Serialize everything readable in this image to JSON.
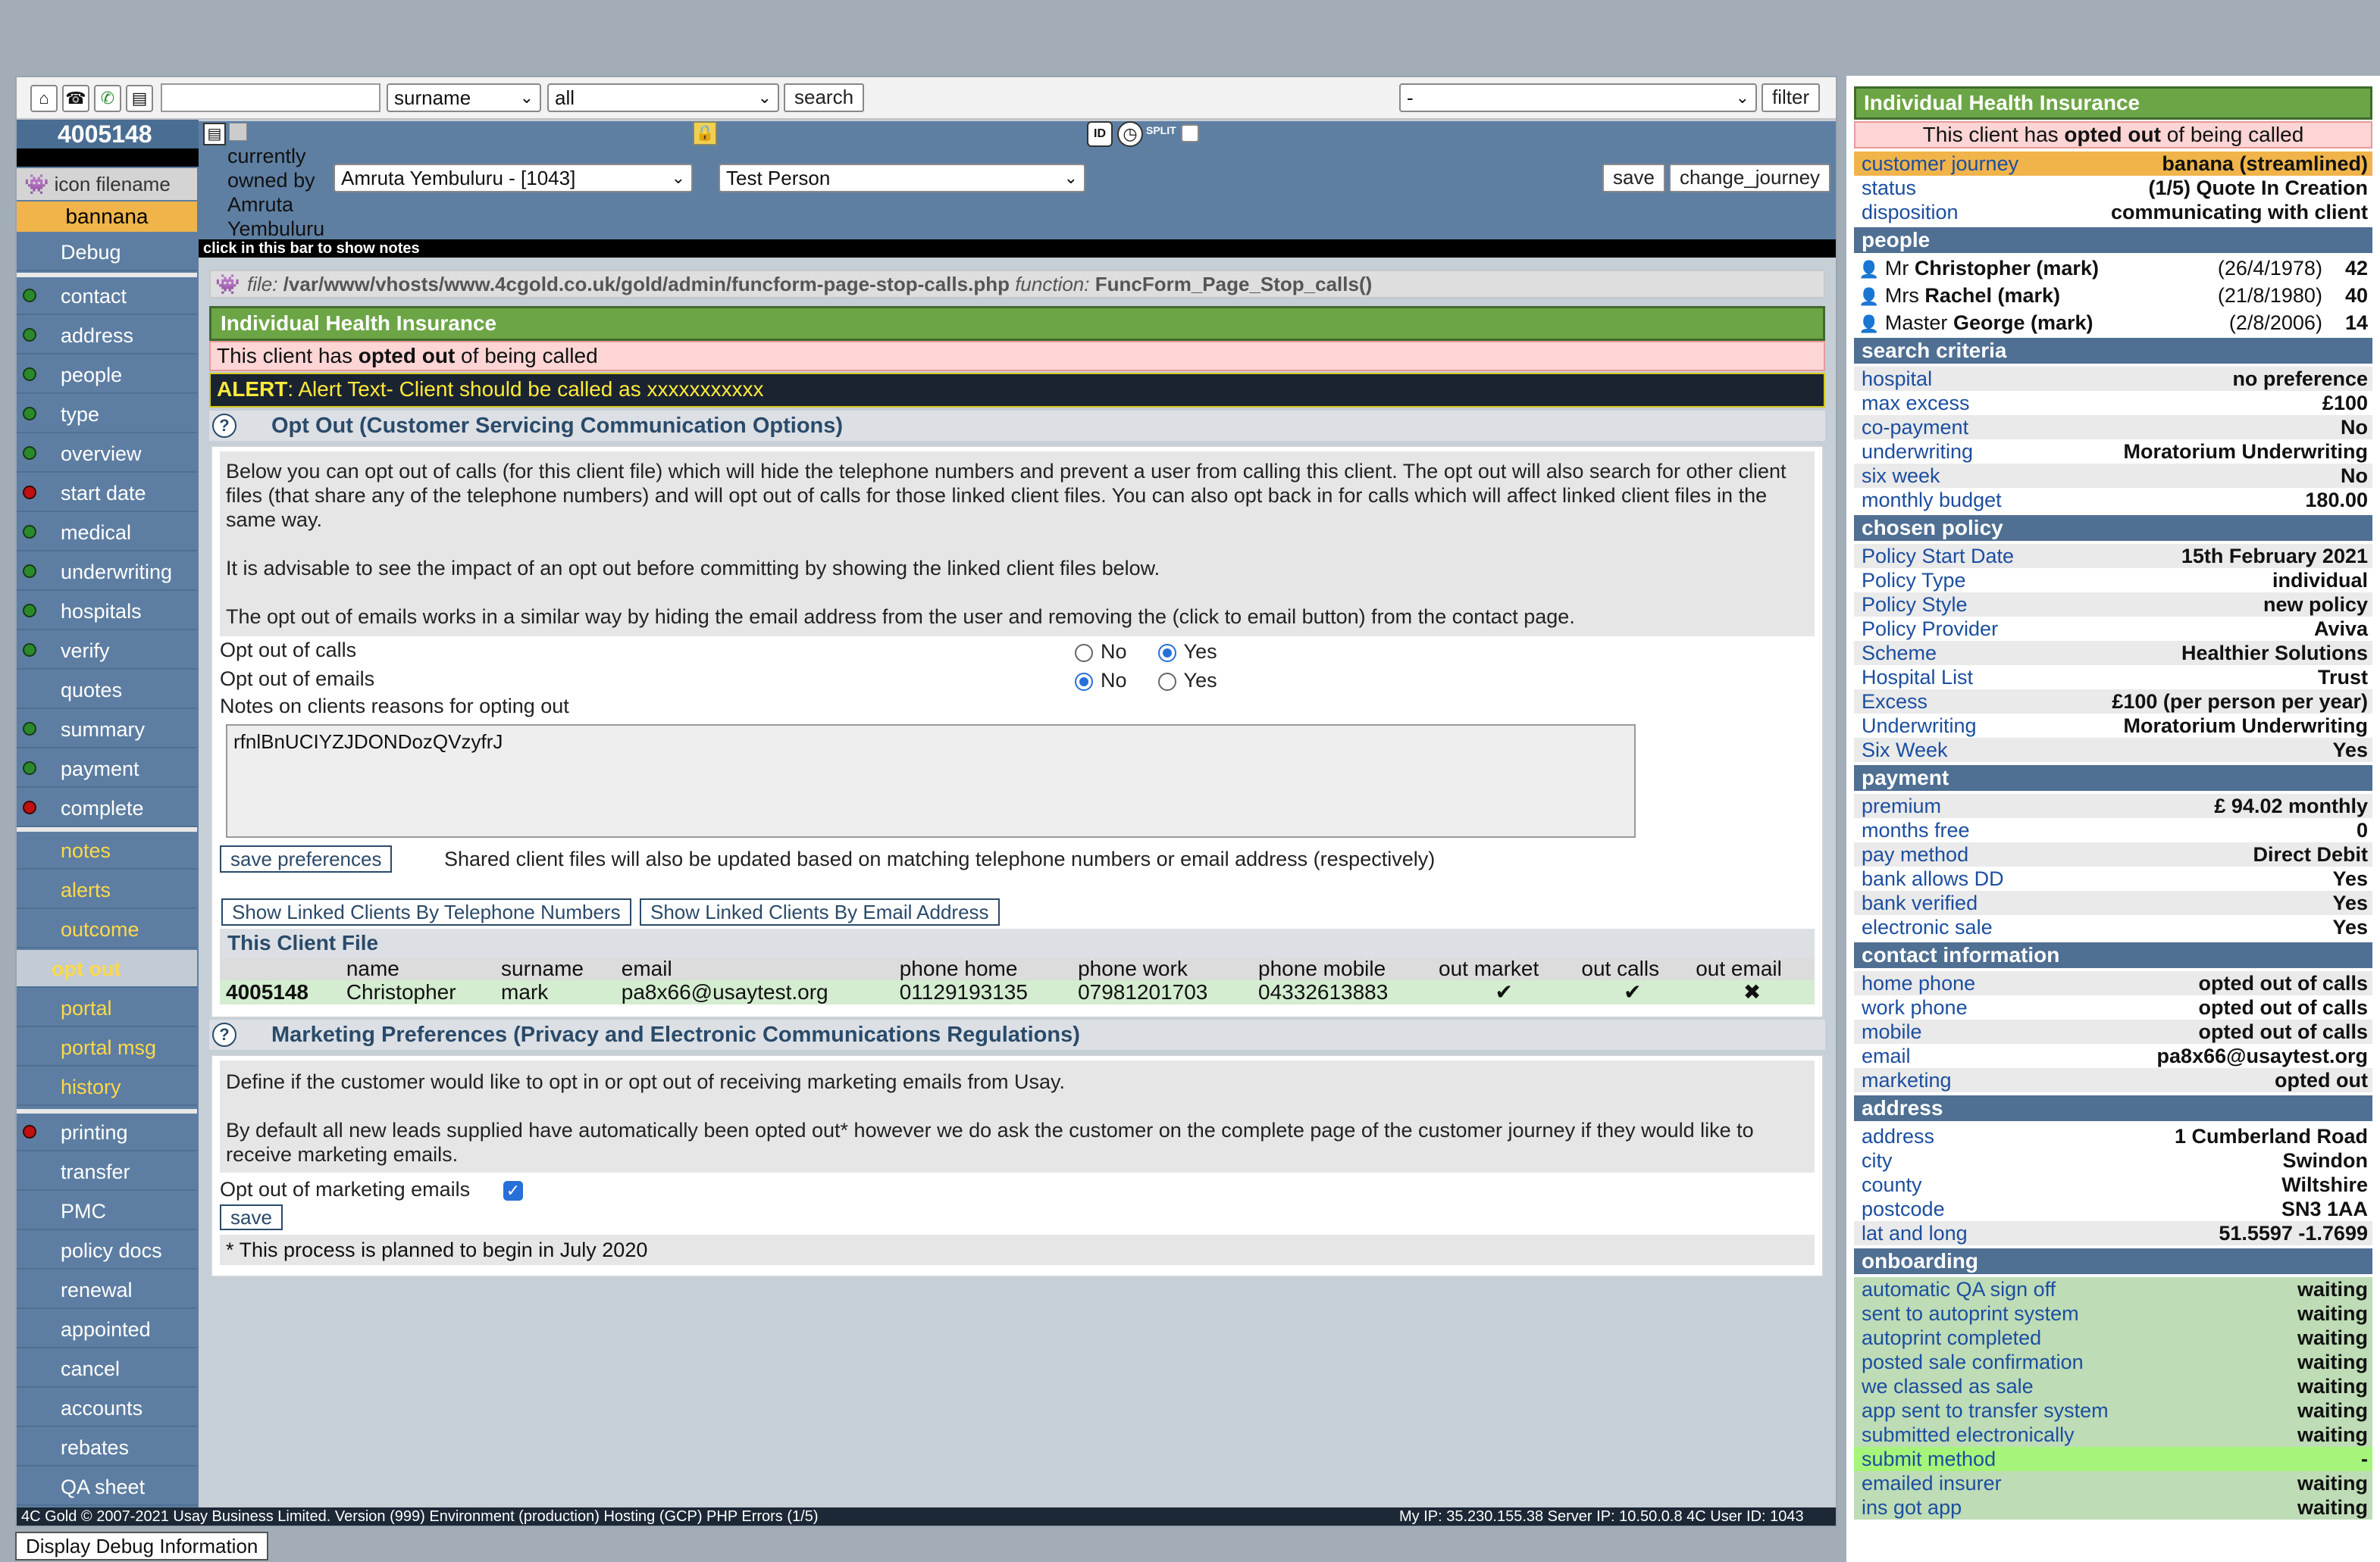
{
  "toolbar": {
    "search_value": "",
    "field_select": "surname",
    "scope_select": "all",
    "search_label": "search",
    "filter_select": "-",
    "filter_label": "filter"
  },
  "client": {
    "id": "4005148",
    "icon_filename": "icon filename",
    "journey_tag": "bannana"
  },
  "header": {
    "owned_label": "currently owned by Amruta Yembuluru",
    "owner_select": "Amruta Yembuluru - [1043]",
    "person_select": "Test Person",
    "save_label": "save",
    "change_journey_label": "change_journey",
    "notes_bar": "click in this bar to show notes",
    "split_label": "SPLIT"
  },
  "sidebar": {
    "debug": "Debug",
    "group1": [
      {
        "label": "contact",
        "status": "green"
      },
      {
        "label": "address",
        "status": "green"
      },
      {
        "label": "people",
        "status": "green"
      },
      {
        "label": "type",
        "status": "green"
      },
      {
        "label": "overview",
        "status": "green"
      },
      {
        "label": "start date",
        "status": "red"
      },
      {
        "label": "medical",
        "status": "green"
      },
      {
        "label": "underwriting",
        "status": "green"
      },
      {
        "label": "hospitals",
        "status": "green"
      },
      {
        "label": "verify",
        "status": "green"
      },
      {
        "label": "quotes",
        "status": "none"
      },
      {
        "label": "summary",
        "status": "green"
      },
      {
        "label": "payment",
        "status": "green"
      },
      {
        "label": "complete",
        "status": "red"
      }
    ],
    "group2": [
      "notes",
      "alerts",
      "outcome",
      "opt out",
      "portal",
      "portal msg",
      "history"
    ],
    "group3": [
      {
        "label": "printing",
        "status": "red"
      },
      {
        "label": "transfer"
      },
      {
        "label": "PMC"
      },
      {
        "label": "policy docs"
      },
      {
        "label": "renewal"
      },
      {
        "label": "appointed"
      },
      {
        "label": "cancel"
      },
      {
        "label": "accounts"
      },
      {
        "label": "rebates"
      },
      {
        "label": "QA sheet"
      }
    ]
  },
  "main": {
    "file_label": "file:",
    "file_path": "/var/www/vhosts/www.4cgold.co.uk/gold/admin/funcform-page-stop-calls.php",
    "function_label": "function:",
    "function_name": "FuncForm_Page_Stop_calls()",
    "product": "Individual Health Insurance",
    "optout_banner_a": "This client has ",
    "optout_banner_b": "opted out",
    "optout_banner_c": " of being called",
    "alert_label": "ALERT",
    "alert_text": ": Alert Text- Client should be called as xxxxxxxxxxx",
    "section1_title": "Opt Out (Customer Servicing Communication Options)",
    "p1": "Below you can opt out of calls (for this client file) which will hide the telephone numbers and prevent a user from calling this client. The opt out will also search for other client files (that share any of the telephone numbers) and will opt out of calls for those linked client files. You can also opt back in for calls which will affect linked client files in the same way.",
    "p2": "It is advisable to see the impact of an opt out before committing by showing the linked client files below.",
    "p3": "The opt out of emails works in a similar way by hiding the email address from the user and removing the (click to email button) from the contact page.",
    "opt_calls_label": "Opt out of calls",
    "opt_emails_label": "Opt out of emails",
    "no": "No",
    "yes": "Yes",
    "opt_calls_value": "Yes",
    "opt_emails_value": "No",
    "notes_label": "Notes on clients reasons for opting out",
    "notes_value": "rfnlBnUCIYZJDONDozQVzyfrJ",
    "save_prefs_label": "save preferences",
    "shared_note": "Shared client files will also be updated based on matching telephone numbers or email address (respectively)",
    "show_phone_label": "Show Linked Clients By Telephone Numbers",
    "show_email_label": "Show Linked Clients By Email Address",
    "this_client_file": "This Client File",
    "table_headers": [
      "",
      "name",
      "surname",
      "email",
      "phone home",
      "phone work",
      "phone mobile",
      "out market",
      "out calls",
      "out email"
    ],
    "table_row": [
      "4005148",
      "Christopher",
      "mark",
      "pa8x66@usaytest.org",
      "01129193135",
      "07981201703",
      "04332613883",
      "✔",
      "✔",
      "✖"
    ],
    "section2_title": "Marketing Preferences (Privacy and Electronic Communications Regulations)",
    "m1": "Define if the customer would like to opt in or opt out of receiving marketing emails from Usay.",
    "m2": "By default all new leads supplied have automatically been opted out* however we do ask the customer on the complete page of the customer journey if they would like to receive marketing emails.",
    "opt_marketing_label": "Opt out of marketing emails",
    "opt_marketing_checked": true,
    "save_label": "save",
    "planned_note": "* This process is planned to begin in July 2020"
  },
  "right": {
    "product": "Individual Health Insurance",
    "banner_a": "This client has ",
    "banner_b": "opted out",
    "banner_c": " of being called",
    "top": [
      {
        "k": "customer journey",
        "v": "banana (streamlined)"
      },
      {
        "k": "status",
        "v": "(1/5) Quote In Creation"
      },
      {
        "k": "disposition",
        "v": "communicating with client"
      }
    ],
    "people_head": "people",
    "people": [
      {
        "title": "Mr",
        "name": "Christopher (mark)",
        "dob": "(26/4/1978)",
        "age": "42"
      },
      {
        "title": "Mrs",
        "name": "Rachel (mark)",
        "dob": "(21/8/1980)",
        "age": "40"
      },
      {
        "title": "Master",
        "name": "George (mark)",
        "dob": "(2/8/2006)",
        "age": "14"
      }
    ],
    "search_head": "search criteria",
    "search": [
      {
        "k": "hospital",
        "v": "no preference"
      },
      {
        "k": "max excess",
        "v": "£100"
      },
      {
        "k": "co-payment",
        "v": "No"
      },
      {
        "k": "underwriting",
        "v": "Moratorium Underwriting"
      },
      {
        "k": "six week",
        "v": "No"
      },
      {
        "k": "monthly budget",
        "v": "180.00"
      }
    ],
    "policy_head": "chosen policy",
    "policy": [
      {
        "k": "Policy Start Date",
        "v": "15th February 2021"
      },
      {
        "k": "Policy Type",
        "v": "individual"
      },
      {
        "k": "Policy Style",
        "v": "new policy"
      },
      {
        "k": "Policy Provider",
        "v": "Aviva"
      },
      {
        "k": "Scheme",
        "v": "Healthier Solutions"
      },
      {
        "k": "Hospital List",
        "v": "Trust"
      },
      {
        "k": "Excess",
        "v": "£100 (per person per year)"
      },
      {
        "k": "Underwriting",
        "v": "Moratorium Underwriting"
      },
      {
        "k": "Six Week",
        "v": "Yes"
      }
    ],
    "payment_head": "payment",
    "payment": [
      {
        "k": "premium",
        "v": "£ 94.02 monthly"
      },
      {
        "k": "months free",
        "v": "0"
      },
      {
        "k": "pay method",
        "v": "Direct Debit"
      },
      {
        "k": "bank allows DD",
        "v": "Yes"
      },
      {
        "k": "bank verified",
        "v": "Yes"
      },
      {
        "k": "electronic sale",
        "v": "Yes"
      }
    ],
    "contact_head": "contact information",
    "contact": [
      {
        "k": "home phone",
        "v": "opted out of calls"
      },
      {
        "k": "work phone",
        "v": "opted out of calls"
      },
      {
        "k": "mobile",
        "v": "opted out of calls"
      },
      {
        "k": "email",
        "v": "pa8x66@usaytest.org"
      },
      {
        "k": "marketing",
        "v": "opted out"
      }
    ],
    "address_head": "address",
    "address": [
      {
        "k": "address",
        "v": "1 Cumberland Road"
      },
      {
        "k": "city",
        "v": "Swindon"
      },
      {
        "k": "county",
        "v": "Wiltshire"
      },
      {
        "k": "postcode",
        "v": "SN3 1AA"
      },
      {
        "k": "lat and long",
        "v": "51.5597 -1.7699"
      }
    ],
    "onboarding_head": "onboarding",
    "onboarding": [
      {
        "k": "automatic QA sign off",
        "v": "waiting"
      },
      {
        "k": "sent to autoprint system",
        "v": "waiting"
      },
      {
        "k": "autoprint completed",
        "v": "waiting"
      },
      {
        "k": "posted sale confirmation",
        "v": "waiting"
      },
      {
        "k": "we classed as sale",
        "v": "waiting"
      },
      {
        "k": "app sent to transfer system",
        "v": "waiting"
      },
      {
        "k": "submitted electronically",
        "v": "waiting"
      },
      {
        "k": "submit method",
        "v": "-"
      },
      {
        "k": "emailed insurer",
        "v": "waiting"
      },
      {
        "k": "ins got app",
        "v": "waiting"
      }
    ]
  },
  "footer": {
    "left": "4C Gold © 2007-2021 Usay Business Limited. Version (999) Environment (production) Hosting (GCP) PHP Errors (1/5)",
    "right": "My IP: 35.230.155.38 Server IP: 10.50.0.8 4C User ID: 1043",
    "debug_button": "Display Debug Information"
  },
  "colors": {
    "sidebar": "#5e7fa2",
    "header_blue": "#4f6f93",
    "green_bar": "#6ca545",
    "pink": "#fdd5d5",
    "orange": "#f0b44a",
    "light_green_row": "#bedcb6"
  }
}
